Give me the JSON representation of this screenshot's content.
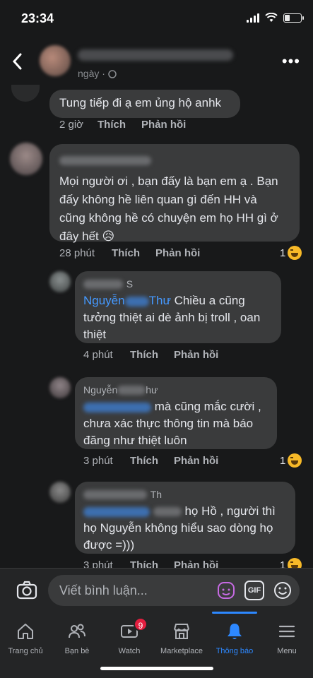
{
  "status_bar": {
    "time": "23:34",
    "battery_level": 0.35
  },
  "post": {
    "time_label": "ngày ·"
  },
  "comments": [
    {
      "text": "Tung tiếp đi ạ em ủng hộ anhk",
      "time": "2 giờ",
      "like": "Thích",
      "reply": "Phản hồi"
    },
    {
      "lines": [
        "Mọi người ơi , bạn đấy là bạn em ạ . Bạn",
        "đấy không hề liên quan gì đến HH và",
        "cũng không hề có chuyện em họ HH gì ở",
        "đây hết 😥"
      ],
      "time": "28 phút",
      "like": "Thích",
      "reply": "Phản hồi",
      "reaction_count": "1"
    },
    {
      "name_tail": "S",
      "mention_a": "Nguyễn",
      "mention_b": "Thư",
      "line1_tail": "Chiều a cũng",
      "line2": "tưởng thiệt ai dè ảnh bị troll , oan",
      "line3": "thiệt",
      "time": "4 phút",
      "like": "Thích",
      "reply": "Phản hồi"
    },
    {
      "name_visible_a": "Nguyễn",
      "name_visible_b": "hư",
      "line1_tail": "mà cũng mắc cười ,",
      "line2": "chưa xác thực thông tin mà báo",
      "line3": "đăng như thiệt luôn",
      "time": "3 phút",
      "like": "Thích",
      "reply": "Phản hồi",
      "reaction_count": "1"
    },
    {
      "name_visible": "Th",
      "line1_tail": "họ Hồ , người thì",
      "line2": "họ Nguyễn không hiểu sao dòng họ",
      "line3": "được =)))",
      "time": "3 phút",
      "like": "Thích",
      "reply": "Phản hồi",
      "reaction_count": "1"
    }
  ],
  "composer": {
    "placeholder": "Viết bình luận...",
    "gif_label": "GIF"
  },
  "tabs": [
    {
      "label": "Trang chủ",
      "icon": "home-icon"
    },
    {
      "label": "Bạn bè",
      "icon": "friends-icon"
    },
    {
      "label": "Watch",
      "icon": "watch-icon",
      "badge": "9"
    },
    {
      "label": "Marketplace",
      "icon": "marketplace-icon"
    },
    {
      "label": "Thông báo",
      "icon": "bell-icon",
      "active": true
    },
    {
      "label": "Menu",
      "icon": "menu-icon"
    }
  ],
  "colors": {
    "accent": "#2d88ff",
    "badge": "#e41e3f",
    "bubble": "#3a3b3c",
    "background": "#18191a"
  }
}
